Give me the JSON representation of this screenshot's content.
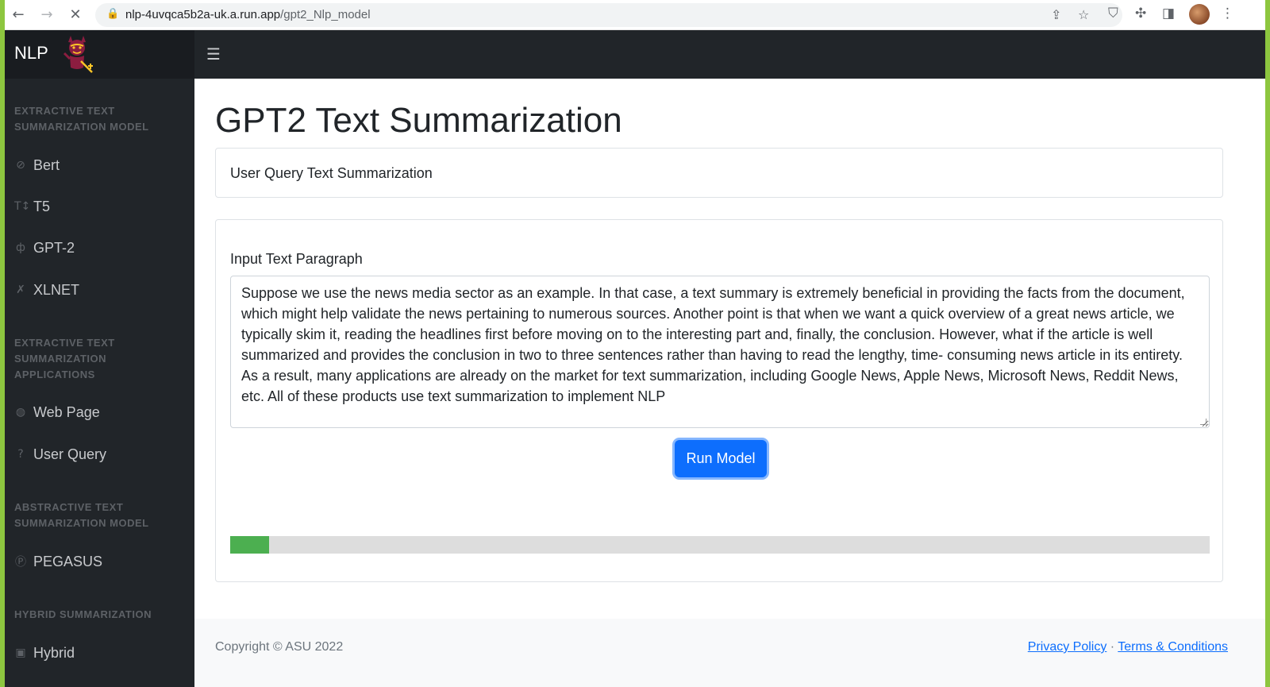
{
  "browser": {
    "url_host": "nlp-4uvqca5b2a-uk.a.run.app",
    "url_path": "/gpt2_Nlp_model",
    "back_icon": "arrow-left-icon",
    "forward_icon": "arrow-right-icon",
    "stop_icon": "close-icon"
  },
  "sidebar": {
    "brand": "NLP",
    "sections": [
      {
        "heading": "EXTRACTIVE TEXT SUMMARIZATION MODEL",
        "items": [
          {
            "label": "Bert",
            "icon": "bert-icon"
          },
          {
            "label": "T5",
            "icon": "text-height-icon"
          },
          {
            "label": "GPT-2",
            "icon": "gpt-icon"
          },
          {
            "label": "XLNET",
            "icon": "xlnet-icon"
          }
        ]
      },
      {
        "heading": "EXTRACTIVE TEXT SUMMARIZATION APPLICATIONS",
        "items": [
          {
            "label": "Web Page",
            "icon": "globe-icon"
          },
          {
            "label": "User Query",
            "icon": "question-circle-icon"
          }
        ]
      },
      {
        "heading": "ABSTRACTIVE TEXT SUMMARIZATION MODEL",
        "items": [
          {
            "label": "PEGASUS",
            "icon": "p-circle-icon"
          }
        ]
      },
      {
        "heading": "HYBRID SUMMARIZATION",
        "items": [
          {
            "label": "Hybrid",
            "icon": "h-square-icon"
          }
        ]
      }
    ]
  },
  "main": {
    "title": "GPT2 Text Summarization",
    "card_header": "User Query Text Summarization",
    "input_label": "Input Text Paragraph",
    "input_value": "Suppose we use the news media sector as an example. In that case, a text summary is extremely beneficial in providing the facts from the document, which might help validate the news pertaining to numerous sources. Another point is that when we want a quick overview of a great news article, we typically skim it, reading the headlines first before moving on to the interesting part and, finally, the conclusion. However, what if the article is well summarized and provides the conclusion in two to three sentences rather than having to read the lengthy, time- consuming news article in its entirety. As a result, many applications are already on the market for text summarization, including Google News, Apple News, Microsoft News, Reddit News, etc. All of these products use text summarization to implement NLP",
    "run_button": "Run Model",
    "progress_percent": 4,
    "progress_color": "#4caf50"
  },
  "footer": {
    "copyright": "Copyright © ASU 2022",
    "privacy": "Privacy Policy",
    "separator": "·",
    "terms": "Terms & Conditions"
  },
  "colors": {
    "sidebar_bg": "#212529",
    "accent": "#0d6efd",
    "outer_border": "#8dc63f"
  }
}
